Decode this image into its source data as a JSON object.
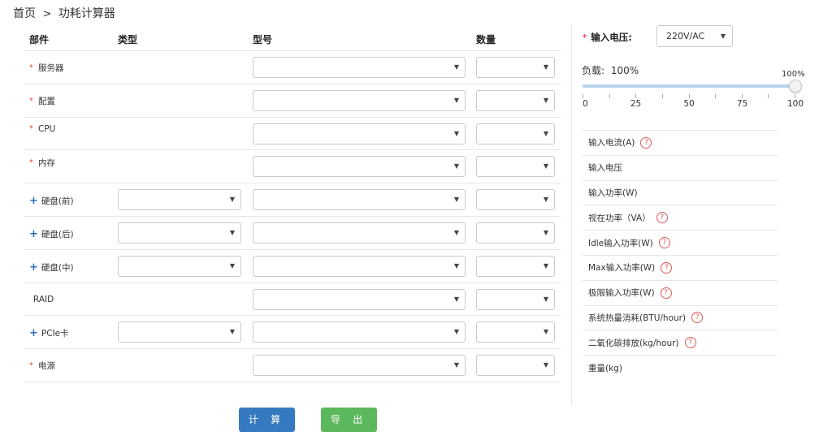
{
  "breadcrumb": {
    "home": "首页",
    "separator": ">",
    "current": "功耗计算器"
  },
  "table": {
    "headers": {
      "part": "部件",
      "type": "类型",
      "model": "型号",
      "qty": "数量"
    },
    "rows": [
      {
        "label": "服务器",
        "marker": "*",
        "has_type": false
      },
      {
        "label": "配置",
        "marker": "*",
        "has_type": false
      },
      {
        "label": "CPU",
        "marker": "*",
        "has_type": false
      },
      {
        "label": "内存",
        "marker": "*",
        "has_type": false
      },
      {
        "label": "硬盘(前)",
        "marker": "+",
        "has_type": true
      },
      {
        "label": "硬盘(后)",
        "marker": "+",
        "has_type": true
      },
      {
        "label": "硬盘(中)",
        "marker": "+",
        "has_type": true
      },
      {
        "label": "RAID",
        "marker": "",
        "has_type": false
      },
      {
        "label": "PCIe卡",
        "marker": "+",
        "has_type": true
      },
      {
        "label": "电源",
        "marker": "*",
        "has_type": false
      }
    ]
  },
  "voltage": {
    "label": "输入电压:",
    "marker": "*",
    "value": "220V/AC"
  },
  "load": {
    "label": "负载:",
    "value": "100%",
    "slider_display": "100%",
    "slider_value": 100,
    "min": 0,
    "max": 100,
    "tick_labels": [
      "0",
      "25",
      "50",
      "75",
      "100"
    ]
  },
  "results": [
    {
      "label": "输入电流(A)",
      "help": true
    },
    {
      "label": "输入电压",
      "help": false
    },
    {
      "label": "输入功率(W)",
      "help": false
    },
    {
      "label": "视在功率（VA）",
      "help": true
    },
    {
      "label": "Idle输入功率(W)",
      "help": true
    },
    {
      "label": "Max输入功率(W)",
      "help": true
    },
    {
      "label": "极限输入功率(W)",
      "help": true
    },
    {
      "label": "系统热量消耗(BTU/hour)",
      "help": true
    },
    {
      "label": "二氧化碳排放(kg/hour)",
      "help": true
    },
    {
      "label": "重量(kg)",
      "help": false
    }
  ],
  "help_glyph": "?",
  "select_arrow": "▼",
  "buttons": {
    "calculate": "计 算",
    "export": "导 出"
  },
  "colors": {
    "primary": "#3579c0",
    "success": "#5cb85c",
    "required": "#e0464c",
    "plus": "#2f6db4"
  }
}
